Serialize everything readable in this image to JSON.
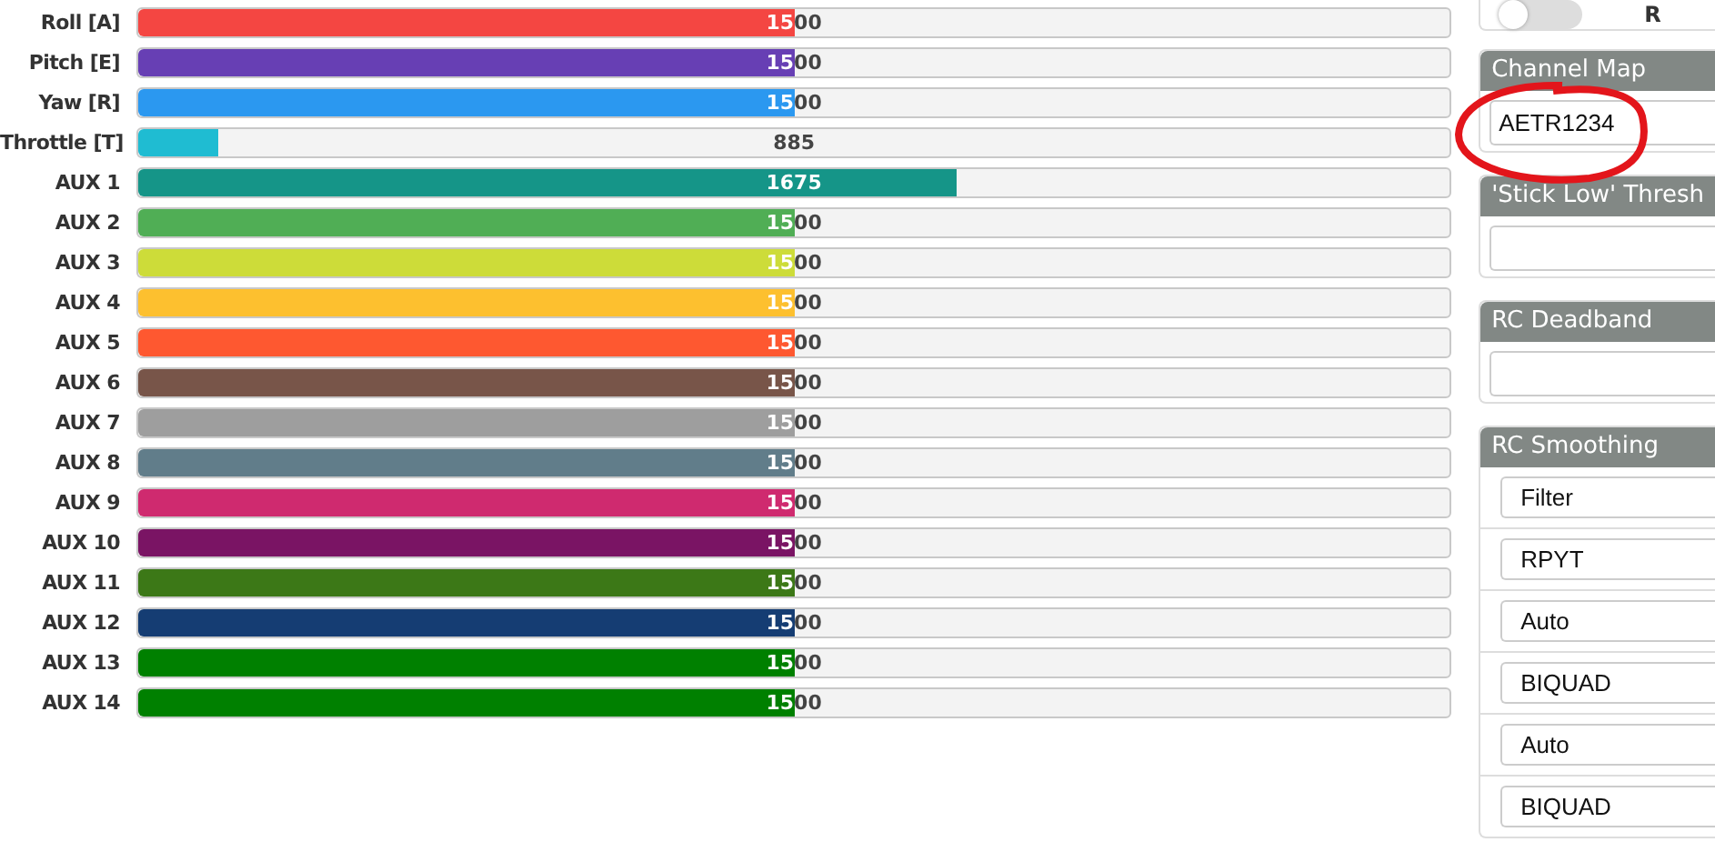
{
  "channels": [
    {
      "name": "Roll [A]",
      "value": "1500",
      "level": 0.5,
      "color": "#f44642"
    },
    {
      "name": "Pitch [E]",
      "value": "1500",
      "level": 0.5,
      "color": "#673fb4"
    },
    {
      "name": "Yaw [R]",
      "value": "1500",
      "level": 0.5,
      "color": "#2b98f0"
    },
    {
      "name": "Throttle [T]",
      "value": "885",
      "level": 0.061,
      "color": "#1fbcd2"
    },
    {
      "name": "AUX 1",
      "value": "1675",
      "level": 0.624,
      "color": "#159588"
    },
    {
      "name": "AUX 2",
      "value": "1500",
      "level": 0.5,
      "color": "#50ae55"
    },
    {
      "name": "AUX 3",
      "value": "1500",
      "level": 0.5,
      "color": "#cddc39"
    },
    {
      "name": "AUX 4",
      "value": "1500",
      "level": 0.5,
      "color": "#fdc02f"
    },
    {
      "name": "AUX 5",
      "value": "1500",
      "level": 0.5,
      "color": "#fe5830"
    },
    {
      "name": "AUX 6",
      "value": "1500",
      "level": 0.5,
      "color": "#785549"
    },
    {
      "name": "AUX 7",
      "value": "1500",
      "level": 0.5,
      "color": "#9e9e9e"
    },
    {
      "name": "AUX 8",
      "value": "1500",
      "level": 0.5,
      "color": "#617d8a"
    },
    {
      "name": "AUX 9",
      "value": "1500",
      "level": 0.5,
      "color": "#cf2a6f"
    },
    {
      "name": "AUX 10",
      "value": "1500",
      "level": 0.5,
      "color": "#7a1464"
    },
    {
      "name": "AUX 11",
      "value": "1500",
      "level": 0.5,
      "color": "#3c7817"
    },
    {
      "name": "AUX 12",
      "value": "1500",
      "level": 0.5,
      "color": "#153d73"
    },
    {
      "name": "AUX 13",
      "value": "1500",
      "level": 0.5,
      "color": "#008000"
    },
    {
      "name": "AUX 14",
      "value": "1500",
      "level": 0.5,
      "color": "#008000"
    }
  ],
  "sidebar": {
    "toggle": {
      "on": false,
      "label": "R"
    },
    "channel_map": {
      "title": "Channel Map",
      "value": "AETR1234"
    },
    "stick_low": {
      "title": "'Stick Low' Thresh"
    },
    "deadband": {
      "title": "RC Deadband"
    },
    "smoothing": {
      "title": "RC Smoothing",
      "selects": [
        "Filter",
        "RPYT",
        "Auto",
        "BIQUAD",
        "Auto",
        "BIQUAD"
      ]
    }
  }
}
